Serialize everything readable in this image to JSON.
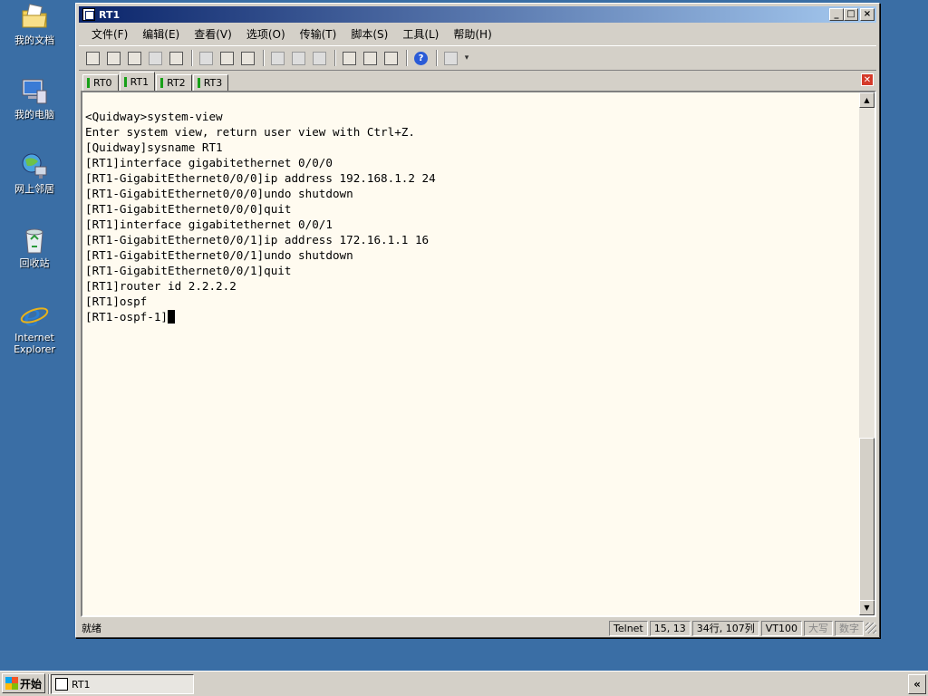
{
  "desktop": {
    "icons": [
      {
        "label": "我的文档",
        "icon": "folder-documents-icon"
      },
      {
        "label": "我的电脑",
        "icon": "computer-icon"
      },
      {
        "label": "网上邻居",
        "icon": "network-icon"
      },
      {
        "label": "回收站",
        "icon": "recycle-bin-icon"
      },
      {
        "label": "Internet Explorer",
        "icon": "internet-explorer-icon"
      }
    ]
  },
  "window": {
    "title": "RT1",
    "menu": [
      "文件(F)",
      "编辑(E)",
      "查看(V)",
      "选项(O)",
      "传输(T)",
      "脚本(S)",
      "工具(L)",
      "帮助(H)"
    ],
    "tabs": [
      {
        "label": "RT0",
        "active": false
      },
      {
        "label": "RT1",
        "active": true
      },
      {
        "label": "RT2",
        "active": false
      },
      {
        "label": "RT3",
        "active": false
      }
    ],
    "terminal_lines": [
      "<Quidway>system-view",
      "Enter system view, return user view with Ctrl+Z.",
      "[Quidway]sysname RT1",
      "[RT1]interface gigabitethernet 0/0/0",
      "[RT1-GigabitEthernet0/0/0]ip address 192.168.1.2 24",
      "[RT1-GigabitEthernet0/0/0]undo shutdown",
      "[RT1-GigabitEthernet0/0/0]quit",
      "[RT1]interface gigabitethernet 0/0/1",
      "[RT1-GigabitEthernet0/0/1]ip address 172.16.1.1 16",
      "[RT1-GigabitEthernet0/0/1]undo shutdown",
      "[RT1-GigabitEthernet0/0/1]quit",
      "[RT1]router id 2.2.2.2",
      "[RT1]ospf",
      "[RT1-ospf-1]"
    ],
    "status": {
      "ready": "就绪",
      "protocol": "Telnet",
      "position": "15, 13",
      "size": "34行, 107列",
      "emulation": "VT100",
      "caps": "大写",
      "num": "数字"
    }
  },
  "taskbar": {
    "start_label": "开始",
    "task_label": "RT1"
  },
  "colors": {
    "desktop": "#3a6ea5",
    "titlebar_start": "#0a246a",
    "titlebar_end": "#a6caf0",
    "terminal_bg": "#fffbf0",
    "tab_marker": "#18a018"
  }
}
